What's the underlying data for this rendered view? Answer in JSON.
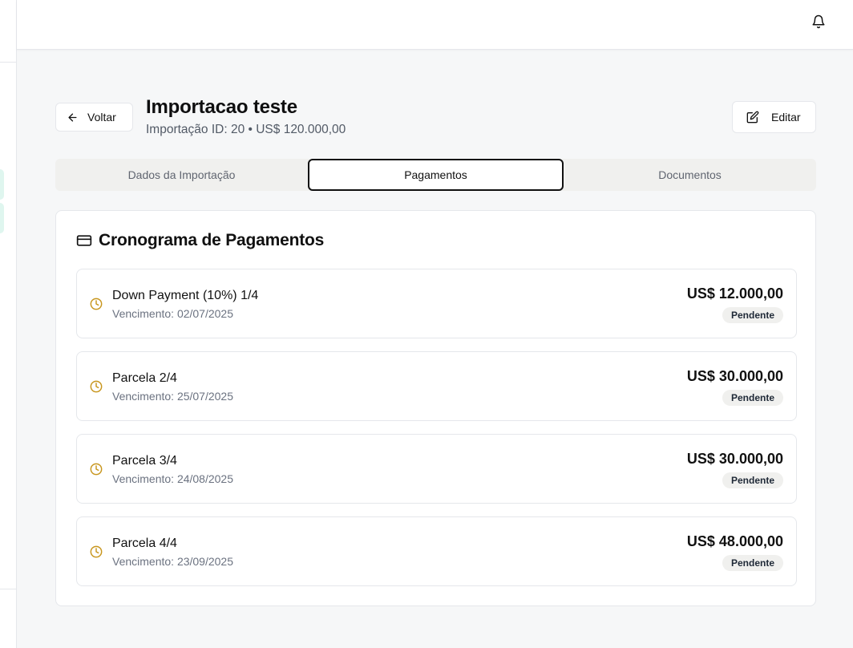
{
  "header": {
    "back_label": "Voltar",
    "title": "Importacao teste",
    "subtitle": "Importação ID: 20 • US$ 120.000,00",
    "edit_label": "Editar"
  },
  "tabs": [
    {
      "label": "Dados da Importação",
      "active": false
    },
    {
      "label": "Pagamentos",
      "active": true
    },
    {
      "label": "Documentos",
      "active": false
    }
  ],
  "schedule": {
    "title": "Cronograma de Pagamentos",
    "payments": [
      {
        "name": "Down Payment (10%) 1/4",
        "due": "Vencimento: 02/07/2025",
        "amount": "US$ 12.000,00",
        "status": "Pendente"
      },
      {
        "name": "Parcela 2/4",
        "due": "Vencimento: 25/07/2025",
        "amount": "US$ 30.000,00",
        "status": "Pendente"
      },
      {
        "name": "Parcela 3/4",
        "due": "Vencimento: 24/08/2025",
        "amount": "US$ 30.000,00",
        "status": "Pendente"
      },
      {
        "name": "Parcela 4/4",
        "due": "Vencimento: 23/09/2025",
        "amount": "US$ 48.000,00",
        "status": "Pendente"
      }
    ]
  },
  "colors": {
    "pending_icon": "#c8961e",
    "active_tab_border": "#111111"
  }
}
